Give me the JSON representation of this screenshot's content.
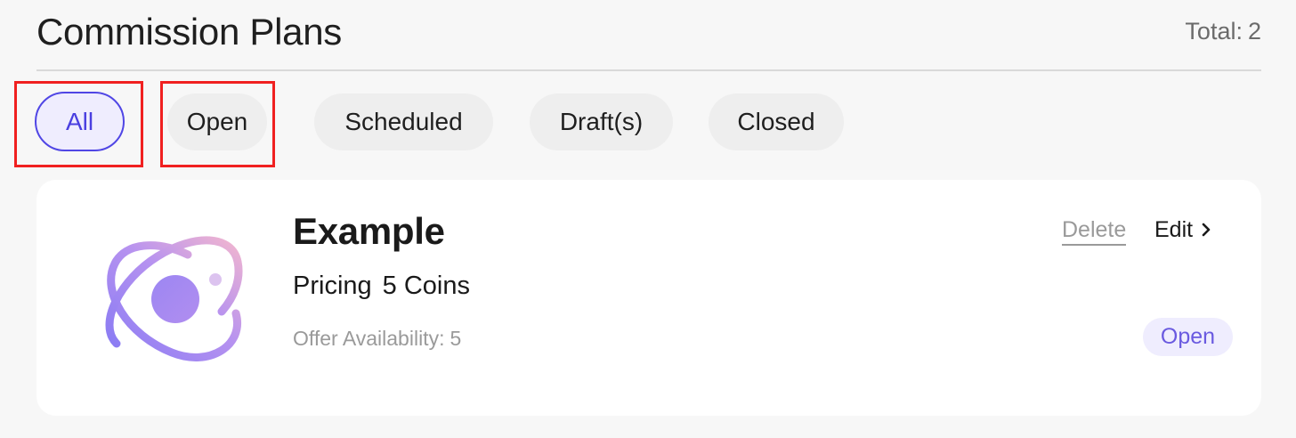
{
  "header": {
    "title": "Commission Plans",
    "total_label": "Total:",
    "total_value": "2"
  },
  "tabs": [
    {
      "label": "All",
      "active": true
    },
    {
      "label": "Open",
      "active": false
    },
    {
      "label": "Scheduled",
      "active": false
    },
    {
      "label": "Draft(s)",
      "active": false
    },
    {
      "label": "Closed",
      "active": false
    }
  ],
  "plans": [
    {
      "name": "Example",
      "pricing_label": "Pricing",
      "pricing_value": "5 Coins",
      "availability_label": "Offer Availability:",
      "availability_value": "5",
      "delete_label": "Delete",
      "edit_label": "Edit",
      "status": "Open",
      "icon": "planet-orbit-icon"
    }
  ],
  "colors": {
    "accent": "#5046e5",
    "accent_bg": "#efedfe",
    "highlight": "#f02020"
  }
}
